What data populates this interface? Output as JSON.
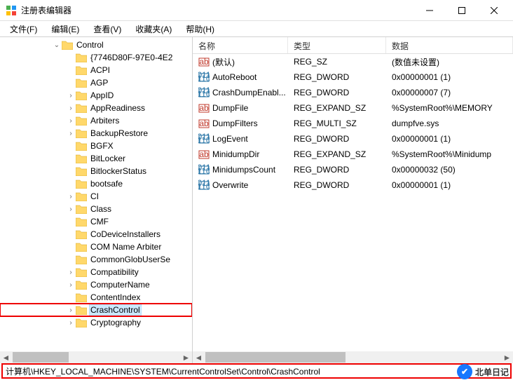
{
  "window": {
    "title": "注册表编辑器"
  },
  "menu": {
    "file": "文件(F)",
    "edit": "编辑(E)",
    "view": "查看(V)",
    "favorites": "收藏夹(A)",
    "help": "帮助(H)"
  },
  "tree": {
    "root_expanded": "Control",
    "items": [
      "{7746D80F-97E0-4E2",
      "ACPI",
      "AGP",
      "AppID",
      "AppReadiness",
      "Arbiters",
      "BackupRestore",
      "BGFX",
      "BitLocker",
      "BitlockerStatus",
      "bootsafe",
      "CI",
      "Class",
      "CMF",
      "CoDeviceInstallers",
      "COM Name Arbiter",
      "CommonGlobUserSe",
      "Compatibility",
      "ComputerName",
      "ContentIndex",
      "CrashControl",
      "Cryptography"
    ],
    "selected": "CrashControl"
  },
  "list": {
    "headers": {
      "name": "名称",
      "type": "类型",
      "data": "数据"
    },
    "rows": [
      {
        "icon": "sz",
        "name": "(默认)",
        "type": "REG_SZ",
        "data": "(数值未设置)"
      },
      {
        "icon": "dw",
        "name": "AutoReboot",
        "type": "REG_DWORD",
        "data": "0x00000001 (1)"
      },
      {
        "icon": "dw",
        "name": "CrashDumpEnabl...",
        "type": "REG_DWORD",
        "data": "0x00000007 (7)"
      },
      {
        "icon": "sz",
        "name": "DumpFile",
        "type": "REG_EXPAND_SZ",
        "data": "%SystemRoot%\\MEMORY"
      },
      {
        "icon": "sz",
        "name": "DumpFilters",
        "type": "REG_MULTI_SZ",
        "data": "dumpfve.sys"
      },
      {
        "icon": "dw",
        "name": "LogEvent",
        "type": "REG_DWORD",
        "data": "0x00000001 (1)"
      },
      {
        "icon": "sz",
        "name": "MinidumpDir",
        "type": "REG_EXPAND_SZ",
        "data": "%SystemRoot%\\Minidump"
      },
      {
        "icon": "dw",
        "name": "MinidumpsCount",
        "type": "REG_DWORD",
        "data": "0x00000032 (50)"
      },
      {
        "icon": "dw",
        "name": "Overwrite",
        "type": "REG_DWORD",
        "data": "0x00000001 (1)"
      }
    ]
  },
  "statusbar": {
    "path": "计算机\\HKEY_LOCAL_MACHINE\\SYSTEM\\CurrentControlSet\\Control\\CrashControl"
  },
  "watermark": {
    "text": "北单日记"
  }
}
